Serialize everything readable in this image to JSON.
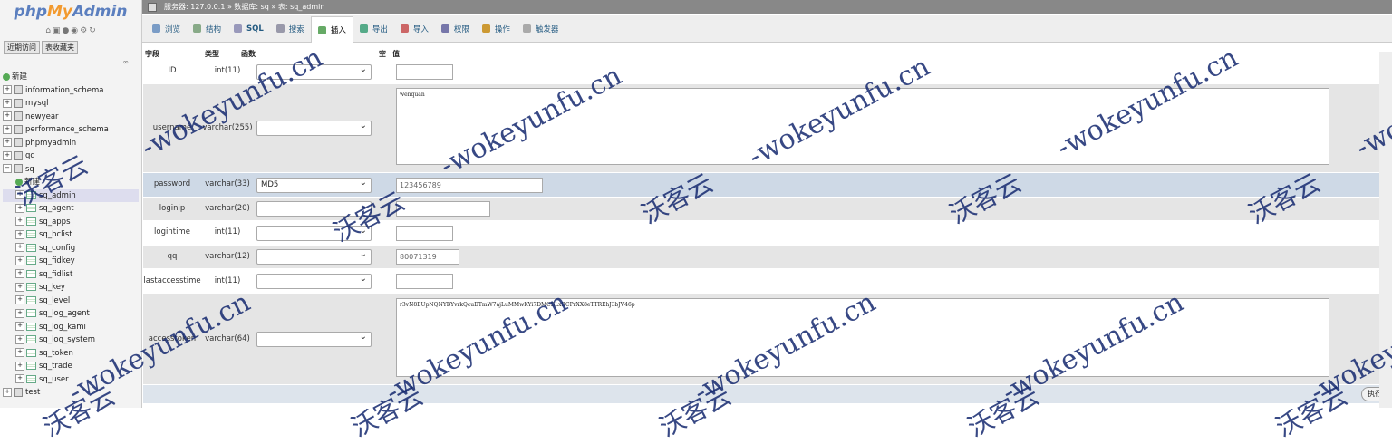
{
  "left": {
    "logo_php": "php",
    "logo_my": "My",
    "logo_admin": "Admin",
    "tabs": [
      "近期访问",
      "表收藏夹"
    ],
    "collapse_label": "∞",
    "tree": [
      {
        "label": "新建",
        "kind": "new",
        "level": 0
      },
      {
        "label": "information_schema",
        "kind": "db",
        "level": 0
      },
      {
        "label": "mysql",
        "kind": "db",
        "level": 0
      },
      {
        "label": "newyear",
        "kind": "db",
        "level": 0
      },
      {
        "label": "performance_schema",
        "kind": "db",
        "level": 0
      },
      {
        "label": "phpmyadmin",
        "kind": "db",
        "level": 0
      },
      {
        "label": "qq",
        "kind": "db",
        "level": 0
      },
      {
        "label": "sq",
        "kind": "db-open",
        "level": 0
      },
      {
        "label": "新建",
        "kind": "new",
        "level": 1
      },
      {
        "label": "sq_admin",
        "kind": "table",
        "level": 1,
        "selected": true
      },
      {
        "label": "sq_agent",
        "kind": "table",
        "level": 1
      },
      {
        "label": "sq_apps",
        "kind": "table",
        "level": 1
      },
      {
        "label": "sq_bclist",
        "kind": "table",
        "level": 1
      },
      {
        "label": "sq_config",
        "kind": "table",
        "level": 1
      },
      {
        "label": "sq_fidkey",
        "kind": "table",
        "level": 1
      },
      {
        "label": "sq_fidlist",
        "kind": "table",
        "level": 1
      },
      {
        "label": "sq_key",
        "kind": "table",
        "level": 1
      },
      {
        "label": "sq_level",
        "kind": "table",
        "level": 1
      },
      {
        "label": "sq_log_agent",
        "kind": "table",
        "level": 1
      },
      {
        "label": "sq_log_kami",
        "kind": "table",
        "level": 1
      },
      {
        "label": "sq_log_system",
        "kind": "table",
        "level": 1
      },
      {
        "label": "sq_token",
        "kind": "table",
        "level": 1
      },
      {
        "label": "sq_trade",
        "kind": "table",
        "level": 1
      },
      {
        "label": "sq_user",
        "kind": "table",
        "level": 1
      },
      {
        "label": "test",
        "kind": "db",
        "level": 0
      }
    ]
  },
  "breadcrumb": "服务器: 127.0.0.1 » 数据库: sq » 表: sq_admin",
  "tabs": [
    {
      "label": "浏览",
      "color": "#7a9cc6"
    },
    {
      "label": "结构",
      "color": "#8a8"
    },
    {
      "label": "SQL",
      "color": "#99b",
      "bold": true
    },
    {
      "label": "搜索",
      "color": "#99a"
    },
    {
      "label": "插入",
      "color": "#6a6",
      "active": true
    },
    {
      "label": "导出",
      "color": "#5a8"
    },
    {
      "label": "导入",
      "color": "#c66"
    },
    {
      "label": "权限",
      "color": "#77a"
    },
    {
      "label": "操作",
      "color": "#c93"
    },
    {
      "label": "触发器",
      "color": "#aaa"
    }
  ],
  "table_header": {
    "field": "字段",
    "type": "类型",
    "func": "函数",
    "null": "空",
    "value": "值"
  },
  "rows": [
    {
      "field": "ID",
      "type": "int(11)",
      "func": "",
      "value": "",
      "style": "odd",
      "kind": "input"
    },
    {
      "field": "username",
      "type": "varchar(255)",
      "func": "",
      "value": "wenquan",
      "style": "even",
      "kind": "area"
    },
    {
      "field": "password",
      "type": "varchar(33)",
      "func": "MD5",
      "value": "123456789",
      "style": "hl",
      "kind": "input"
    },
    {
      "field": "loginip",
      "type": "varchar(20)",
      "func": "",
      "value": "",
      "style": "even",
      "kind": "input"
    },
    {
      "field": "logintime",
      "type": "int(11)",
      "func": "",
      "value": "",
      "style": "odd",
      "kind": "input"
    },
    {
      "field": "qq",
      "type": "varchar(12)",
      "func": "",
      "value": "80071319",
      "style": "even",
      "kind": "input"
    },
    {
      "field": "lastaccesstime",
      "type": "int(11)",
      "func": "",
      "value": "",
      "style": "odd",
      "kind": "input"
    },
    {
      "field": "accesstoken",
      "type": "varchar(64)",
      "func": "",
      "value": "r3vN8EUpNQNYBYvrkQcuDTmW7ajLuMMwKYi7DMCBLxBCPrXX8eTTREhJ3bJV46p",
      "style": "even",
      "kind": "area"
    }
  ],
  "go_label": "执行",
  "watermark": {
    "en": "-wokeyunfu.cn",
    "cn": "沃客云"
  }
}
